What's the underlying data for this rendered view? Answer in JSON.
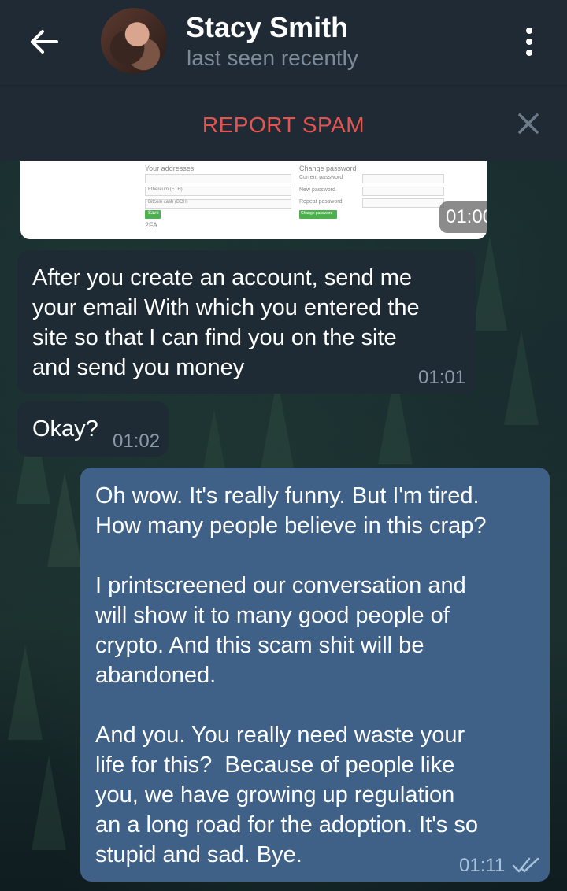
{
  "header": {
    "contact_name": "Stacy Smith",
    "status": "last seen recently",
    "back_icon": "arrow-left-icon",
    "menu_icon": "more-vertical-icon"
  },
  "spam_bar": {
    "label": "REPORT SPAM",
    "close_icon": "close-icon"
  },
  "image_message": {
    "labels": {
      "your_addresses": "Your addresses",
      "change_password": "Change password",
      "current_password": "Current password",
      "new_password": "New password",
      "repeat_password": "Repeat password",
      "ethereum": "Ethereum (ETH)",
      "bitcoin": "Bitcoin cash (BCH)",
      "save": "Save",
      "change_password_btn": "Change password",
      "twofa": "2FA"
    },
    "time": "01:00"
  },
  "messages": [
    {
      "direction": "in",
      "text": "After you create an account, send me\nyour email With which you entered the\nsite so that I can find you on the site\nand send you money",
      "time": "01:01"
    },
    {
      "direction": "in",
      "text": "Okay?",
      "time": "01:02"
    },
    {
      "direction": "out",
      "text": "Oh wow. It's really funny. But I'm tired.\nHow many people believe in this crap?\n\nI printscreened our conversation and\nwill show it to many good people of\ncrypto. And this scam shit will be\nabandoned.\n\nAnd you. You really need waste your\nlife for this?  Because of people like\nyou, we have growing up regulation\nan a long road for the adoption. It's so\nstupid and sad. Bye.",
      "time": "01:11",
      "read_icon": "double-check-icon"
    }
  ],
  "colors": {
    "header_bg": "#1f2a35",
    "incoming_bubble": "#1e2b35",
    "outgoing_bubble": "#3f6187",
    "spam_red": "#e5544f"
  }
}
